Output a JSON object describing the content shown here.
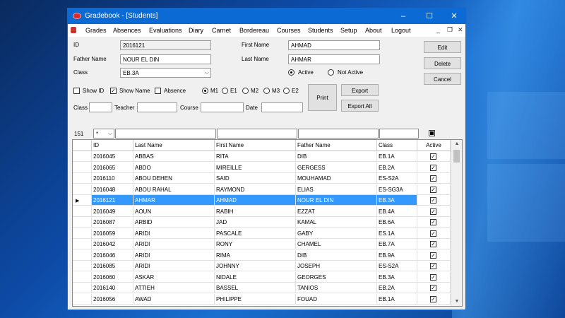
{
  "window": {
    "title": "Gradebook - [Students]",
    "minimize": "–",
    "maximize": "☐",
    "close": "✕"
  },
  "menu": [
    "Grades",
    "Absences",
    "Evaluations",
    "Diary",
    "Carnet",
    "Bordereau",
    "Courses",
    "Students",
    "Setup",
    "About",
    "Logout"
  ],
  "mdi": {
    "minimize": "_",
    "restore": "❐",
    "close": "✕"
  },
  "form": {
    "id_label": "ID",
    "id_value": "2016121",
    "father_label": "Father Name",
    "father_value": "NOUR EL DIN",
    "class_label": "Class",
    "class_value": "EB.3A",
    "first_label": "First Name",
    "first_value": "AHMAD",
    "last_label": "Last Name",
    "last_value": "AHMAR",
    "active_label": "Active",
    "notactive_label": "Not Active",
    "showid": "Show ID",
    "showname": "Show Name",
    "absence": "Absence",
    "m1": "M1",
    "e1": "E1",
    "m2": "M2",
    "m3": "M3",
    "e2": "E2",
    "f_class": "Class",
    "f_teacher": "Teacher",
    "f_course": "Course",
    "f_date": "Date"
  },
  "buttons": {
    "edit": "Edit",
    "delete": "Delete",
    "cancel": "Cancel",
    "print": "Print",
    "export": "Export",
    "export_all": "Export All"
  },
  "filter": {
    "count": "151",
    "combo": "*"
  },
  "grid": {
    "headers": [
      "ID",
      "Last Name",
      "First Name",
      "Father Name",
      "Class",
      "Active"
    ],
    "rows": [
      [
        "2016045",
        "ABBAS",
        "RITA",
        "DIB",
        "EB.1A"
      ],
      [
        "2016065",
        "ABDO",
        "MIREILLE",
        "GERGESS",
        "EB.2A"
      ],
      [
        "2016110",
        "ABOU DEHEN",
        "SAID",
        "MOUHAMAD",
        "ES-S2A"
      ],
      [
        "2016048",
        "ABOU RAHAL",
        "RAYMOND",
        "ELIAS",
        "ES-SG3A"
      ],
      [
        "2016121",
        "AHMAR",
        "AHMAD",
        "NOUR EL DIN",
        "EB.3A"
      ],
      [
        "2016049",
        "AOUN",
        "RABIH",
        "EZZAT",
        "EB.4A"
      ],
      [
        "2016087",
        "ARBID",
        "JAD",
        "KAMAL",
        "EB.6A"
      ],
      [
        "2016059",
        "ARIDI",
        "PASCALE",
        "GABY",
        "ES.1A"
      ],
      [
        "2016042",
        "ARIDI",
        "RONY",
        "CHAMEL",
        "EB.7A"
      ],
      [
        "2016046",
        "ARIDI",
        "RIMA",
        "DIB",
        "EB.9A"
      ],
      [
        "2016085",
        "ARIDI",
        "JOHNNY",
        "JOSEPH",
        "ES-S2A"
      ],
      [
        "2016060",
        "ASKAR",
        "NIDALE",
        "GEORGES",
        "EB.3A"
      ],
      [
        "2016140",
        "ATTIEH",
        "BASSEL",
        "TANIOS",
        "EB.2A"
      ],
      [
        "2016056",
        "AWAD",
        "PHILIPPE",
        "FOUAD",
        "EB.1A"
      ]
    ],
    "selected_index": 4,
    "row_pointer": "▶",
    "check": "✓"
  }
}
